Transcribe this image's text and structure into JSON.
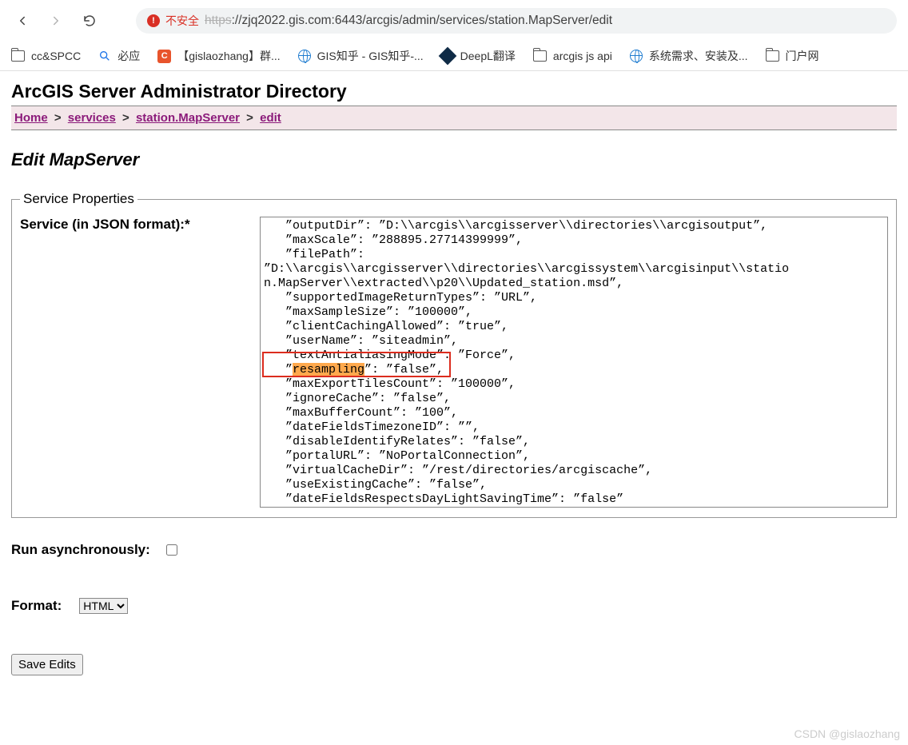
{
  "browser": {
    "insecure_badge": "!",
    "insecure_label": "不安全",
    "url_https": "https",
    "url_rest": "://zjq2022.gis.com:6443/arcgis/admin/services/station.MapServer/edit"
  },
  "bookmarks": [
    {
      "icon": "folder",
      "label": "cc&SPCC"
    },
    {
      "icon": "search",
      "label": "必应"
    },
    {
      "icon": "orange-c",
      "label": "【gislaozhang】群..."
    },
    {
      "icon": "globe",
      "label": "GIS知乎 - GIS知乎-..."
    },
    {
      "icon": "deepl",
      "label": "DeepL翻译"
    },
    {
      "icon": "folder",
      "label": "arcgis js api"
    },
    {
      "icon": "globe",
      "label": "系统需求、安装及..."
    },
    {
      "icon": "folder",
      "label": "门户网"
    }
  ],
  "page": {
    "title": "ArcGIS Server Administrator Directory",
    "breadcrumb": [
      {
        "label": "Home",
        "link": true
      },
      {
        "label": "services",
        "link": true
      },
      {
        "label": "station.MapServer",
        "link": true
      },
      {
        "label": "edit",
        "link": true
      }
    ],
    "heading": "Edit MapServer",
    "fieldset_legend": "Service Properties",
    "json_label": "Service (in JSON format):*",
    "json_lines": [
      "   \"outputDir\": \"D:\\\\arcgis\\\\arcgisserver\\\\directories\\\\arcgisoutput\",",
      "   \"maxScale\": \"288895.27714399999\",",
      "   \"filePath\":",
      "\"D:\\\\arcgis\\\\arcgisserver\\\\directories\\\\arcgissystem\\\\arcgisinput\\\\statio",
      "n.MapServer\\\\extracted\\\\p20\\\\Updated_station.msd\",",
      "   \"supportedImageReturnTypes\": \"URL\",",
      "   \"maxSampleSize\": \"100000\",",
      "   \"clientCachingAllowed\": \"true\",",
      "   \"userName\": \"siteadmin\",",
      "   \"textAntialiasingMode\": \"Force\",",
      "   \"resampling\": \"false\",",
      "   \"maxExportTilesCount\": \"100000\",",
      "   \"ignoreCache\": \"false\",",
      "   \"maxBufferCount\": \"100\",",
      "   \"dateFieldsTimezoneID\": \"\",",
      "   \"disableIdentifyRelates\": \"false\",",
      "   \"portalURL\": \"NoPortalConnection\",",
      "   \"virtualCacheDir\": \"/rest/directories/arcgiscache\",",
      "   \"useExistingCache\": \"false\",",
      "   \"dateFieldsRespectsDayLightSavingTime\": \"false\"",
      "  }"
    ],
    "highlight_word": "resampling",
    "run_async_label": "Run asynchronously:",
    "format_label": "Format:",
    "format_value": "HTML",
    "save_button": "Save Edits"
  },
  "watermark": "CSDN @gislaozhang"
}
